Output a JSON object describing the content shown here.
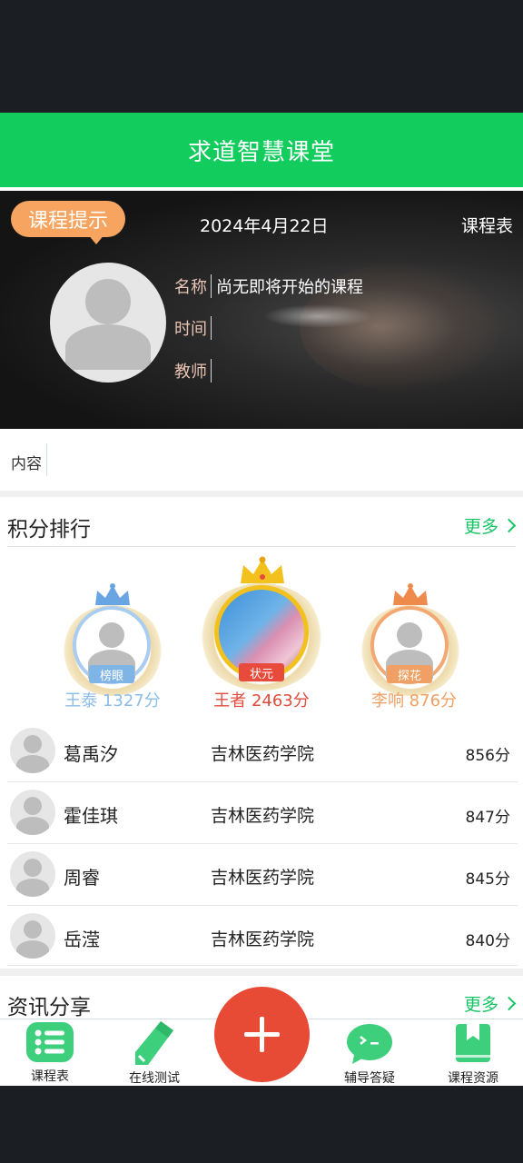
{
  "header": {
    "title": "求道智慧课堂"
  },
  "course": {
    "tip_label": "课程提示",
    "date": "2024年4月22日",
    "schedule_link": "课程表",
    "rows": [
      {
        "key": "名称",
        "value": "尚无即将开始的课程"
      },
      {
        "key": "时间",
        "value": ""
      },
      {
        "key": "教师",
        "value": ""
      }
    ],
    "content_label": "内容"
  },
  "ranking": {
    "title": "积分排行",
    "more": "更多",
    "podium": [
      {
        "rank_tag": "榜眼",
        "name_score": "王泰 1327分",
        "color": "#7fb4e6"
      },
      {
        "rank_tag": "状元",
        "name_score": "王者 2463分",
        "color": "#e84b3c"
      },
      {
        "rank_tag": "探花",
        "name_score": "李响 876分",
        "color": "#f0a064"
      }
    ],
    "rows": [
      {
        "name": "葛禹汐",
        "school": "吉林医药学院",
        "score": "856分"
      },
      {
        "name": "霍佳琪",
        "school": "吉林医药学院",
        "score": "847分"
      },
      {
        "name": "周睿",
        "school": "吉林医药学院",
        "score": "845分"
      },
      {
        "name": "岳滢",
        "school": "吉林医药学院",
        "score": "840分"
      }
    ]
  },
  "news": {
    "title": "资讯分享",
    "more": "更多"
  },
  "tabs": [
    {
      "label": "课程表",
      "icon": "list-icon"
    },
    {
      "label": "在线测试",
      "icon": "pencil-icon"
    },
    {
      "label": "辅导答疑",
      "icon": "chat-icon"
    },
    {
      "label": "课程资源",
      "icon": "bookmark-icon"
    }
  ],
  "colors": {
    "brand_green": "#12cd5e",
    "fab_red": "#e84b35",
    "tip_orange": "#f6a45f"
  }
}
